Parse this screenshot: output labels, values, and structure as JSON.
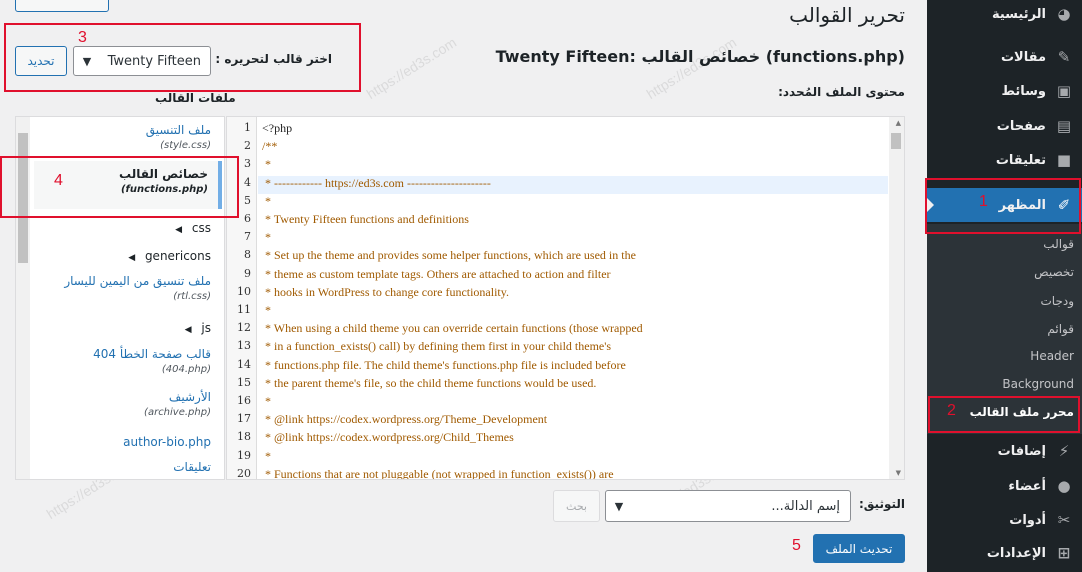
{
  "sidebar": {
    "items": [
      {
        "label": "الرئيسية",
        "icon": "dashboard-icon"
      },
      {
        "label": "مقالات",
        "icon": "pin-icon"
      },
      {
        "label": "وسائط",
        "icon": "media-icon"
      },
      {
        "label": "صفحات",
        "icon": "page-icon"
      },
      {
        "label": "تعليقات",
        "icon": "comment-icon"
      },
      {
        "label": "المظهر",
        "icon": "brush-icon"
      },
      {
        "label": "إضافات",
        "icon": "plugin-icon"
      },
      {
        "label": "أعضاء",
        "icon": "users-icon"
      },
      {
        "label": "أدوات",
        "icon": "wrench-icon"
      },
      {
        "label": "الإعدادات",
        "icon": "settings-icon"
      }
    ],
    "submenu": [
      "قوالب",
      "تخصيص",
      "ودجات",
      "قوائم",
      "Header",
      "Background",
      "محرر ملف القالب"
    ]
  },
  "header": {
    "page_title": "تحرير القوالب",
    "file_heading": "Twenty Fifteen: خصائص القالب (functions.php)",
    "select_label": "اختر قالب لتحريره :",
    "theme_selected": "Twenty Fifteen",
    "select_button": "تحديد",
    "content_label": "محتوى الملف المُحدد:",
    "files_heading": "ملفات القالب"
  },
  "editor": {
    "line_numbers": [
      "1",
      "2",
      "3",
      "4",
      "5",
      "6",
      "7",
      "8",
      "9",
      "10",
      "11",
      "12",
      "13",
      "14",
      "15",
      "16",
      "17",
      "18",
      "19",
      "20"
    ],
    "lines": [
      "<?php",
      "/**",
      " *",
      " * ------------ https://ed3s.com ---------------------",
      " *",
      " * Twenty Fifteen functions and definitions",
      " *",
      " * Set up the theme and provides some helper functions, which are used in the",
      " * theme as custom template tags. Others are attached to action and filter",
      " * hooks in WordPress to change core functionality.",
      " *",
      " * When using a child theme you can override certain functions (those wrapped",
      " * in a function_exists() call) by defining them first in your child theme's",
      " * functions.php file. The child theme's functions.php file is included before",
      " * the parent theme's file, so the child theme functions would be used.",
      " *",
      " * @link https://codex.wordpress.org/Theme_Development",
      " * @link https://codex.wordpress.org/Child_Themes",
      " *",
      " * Functions that are not pluggable (not wrapped in function_exists()) are"
    ]
  },
  "files": {
    "style": {
      "name": "ملف التنسيق",
      "file": "(style.css)"
    },
    "functions": {
      "name": "خصائص القالب",
      "file": "(functions.php)"
    },
    "css_folder": "css",
    "genericons_folder": "genericons",
    "rtl": {
      "name": "ملف تنسيق من اليمين لليسار",
      "file": "(rtl.css)"
    },
    "js_folder": "js",
    "p404": {
      "name": "قالب صفحة الخطأ 404",
      "file": "(404.php)"
    },
    "archive": {
      "name": "الأرشيف",
      "file": "(archive.php)"
    },
    "author_bio": {
      "name": "author-bio.php"
    },
    "comments": {
      "name": "تعليقات"
    }
  },
  "bottom": {
    "doc_label": "التوثيق:",
    "func_placeholder": "إسم الدالة...",
    "lookup_button": "بحث",
    "update_button": "تحديث الملف"
  },
  "annotations": [
    "1",
    "2",
    "3",
    "4",
    "5"
  ],
  "watermark": "https://ed3s.com",
  "colors": {
    "accent": "#2271b1",
    "annotation": "#e0102d",
    "sidebar": "#1d2327"
  }
}
